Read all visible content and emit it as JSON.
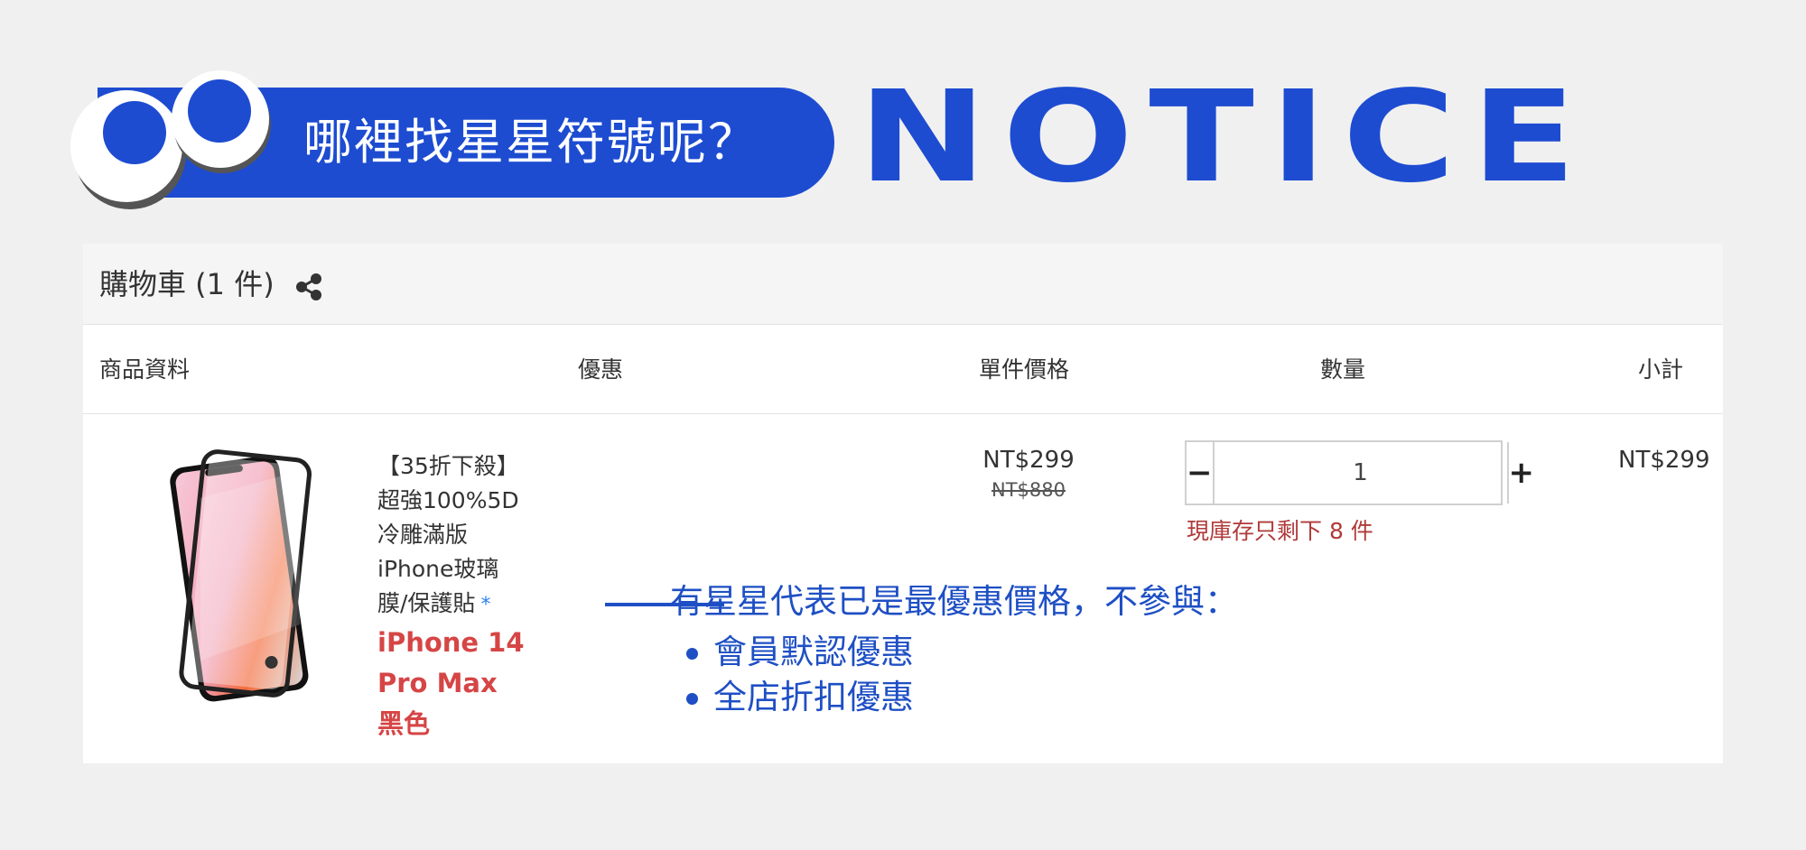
{
  "banner": {
    "title": "哪裡找星星符號呢？",
    "notice": "NOTICE",
    "colors": {
      "accent": "#1d4cd1"
    }
  },
  "cart": {
    "title": "購物車 (1 件)",
    "share_icon": "share-icon",
    "columns": {
      "product": "商品資料",
      "promotion": "優惠",
      "unit_price": "單件價格",
      "quantity": "數量",
      "subtotal": "小計"
    },
    "item": {
      "name_lines": [
        "【35折下殺】",
        "超強100%5D",
        "冷雕滿版",
        "iPhone玻璃",
        "膜/保護貼"
      ],
      "star": "*",
      "variant_lines": [
        "iPhone 14",
        "Pro Max",
        "黑色"
      ],
      "unit_price": "NT$299",
      "original_price": "NT$880",
      "quantity": "1",
      "minus_label": "−",
      "plus_label": "+",
      "stock_note": "現庫存只剩下 8 件",
      "subtotal": "NT$299"
    }
  },
  "annotation": {
    "title": "有星星代表已是最優惠價格，不參與：",
    "items": [
      "會員默認優惠",
      "全店折扣優惠"
    ],
    "color": "#1e4fc4"
  }
}
